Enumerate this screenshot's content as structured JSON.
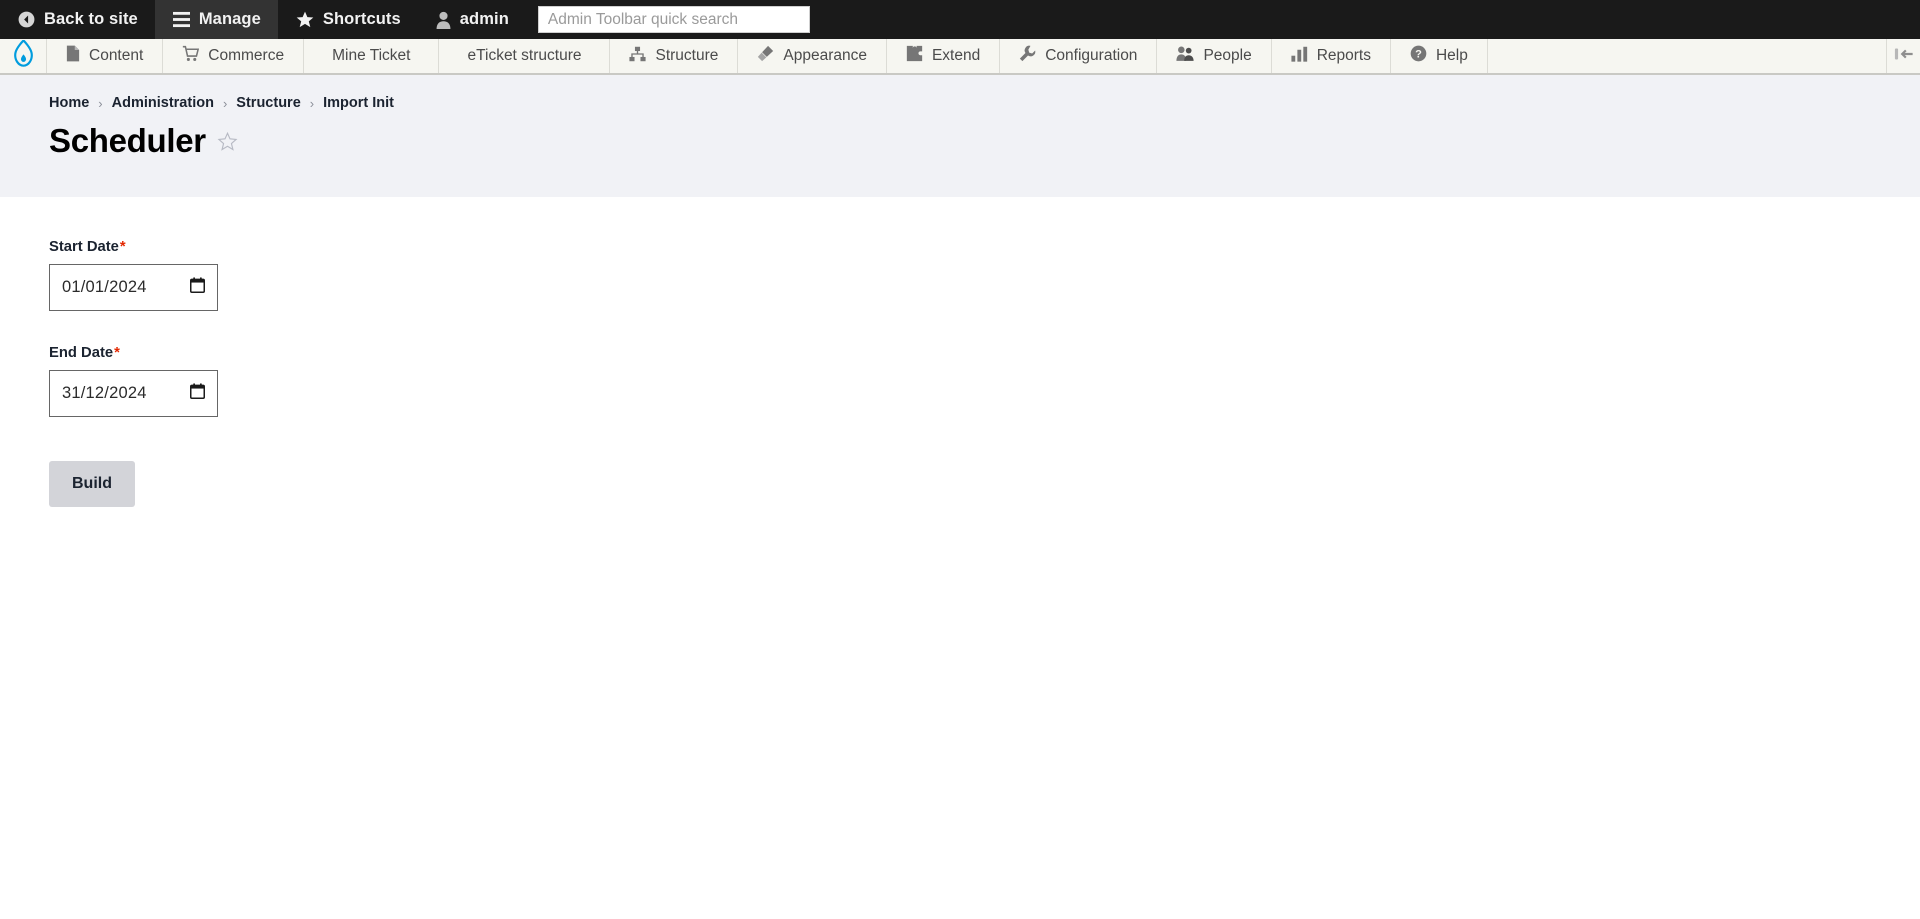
{
  "admin_bar": {
    "items": [
      {
        "label": "Back to site",
        "icon": "back-arrow-circle-icon",
        "active": false
      },
      {
        "label": "Manage",
        "icon": "hamburger-menu-icon",
        "active": true
      },
      {
        "label": "Shortcuts",
        "icon": "star-icon",
        "active": false
      },
      {
        "label": "admin",
        "icon": "user-icon",
        "active": false
      }
    ],
    "search": {
      "placeholder": "Admin Toolbar quick search",
      "value": ""
    }
  },
  "menu_bar": {
    "logo": "drupal-droplet-logo",
    "items": [
      {
        "label": "Content",
        "icon": "page-icon"
      },
      {
        "label": "Commerce",
        "icon": "shopping-cart-icon"
      },
      {
        "label": "Mine Ticket",
        "icon": "none"
      },
      {
        "label": "eTicket structure",
        "icon": "none"
      },
      {
        "label": "Structure",
        "icon": "hierarchy-icon"
      },
      {
        "label": "Appearance",
        "icon": "paintbrush-icon"
      },
      {
        "label": "Extend",
        "icon": "puzzle-piece-icon"
      },
      {
        "label": "Configuration",
        "icon": "wrench-icon"
      },
      {
        "label": "People",
        "icon": "people-icon"
      },
      {
        "label": "Reports",
        "icon": "bar-chart-icon"
      },
      {
        "label": "Help",
        "icon": "question-circle-icon"
      }
    ],
    "toggle_icon": "toolbar-orientation-toggle-icon"
  },
  "breadcrumb": {
    "items": [
      "Home",
      "Administration",
      "Structure",
      "Import Init"
    ],
    "separator": "›"
  },
  "page": {
    "title": "Scheduler",
    "bookmark_icon": "star-outline-icon"
  },
  "form": {
    "start_date": {
      "label": "Start Date",
      "required_marker": "*",
      "value": "01/01/2024",
      "picker_icon": "calendar-icon"
    },
    "end_date": {
      "label": "End Date",
      "required_marker": "*",
      "value": "31/12/2024",
      "picker_icon": "calendar-icon"
    },
    "submit_label": "Build"
  },
  "colors": {
    "toolbar_bg": "#1a1a1a",
    "toolbar_active": "#333333",
    "menu_bg": "#f6f6f1",
    "header_bg": "#f1f2f6",
    "drupal_blue": "#009cde",
    "required_red": "#e32700",
    "button_bg": "#d3d4d9"
  }
}
